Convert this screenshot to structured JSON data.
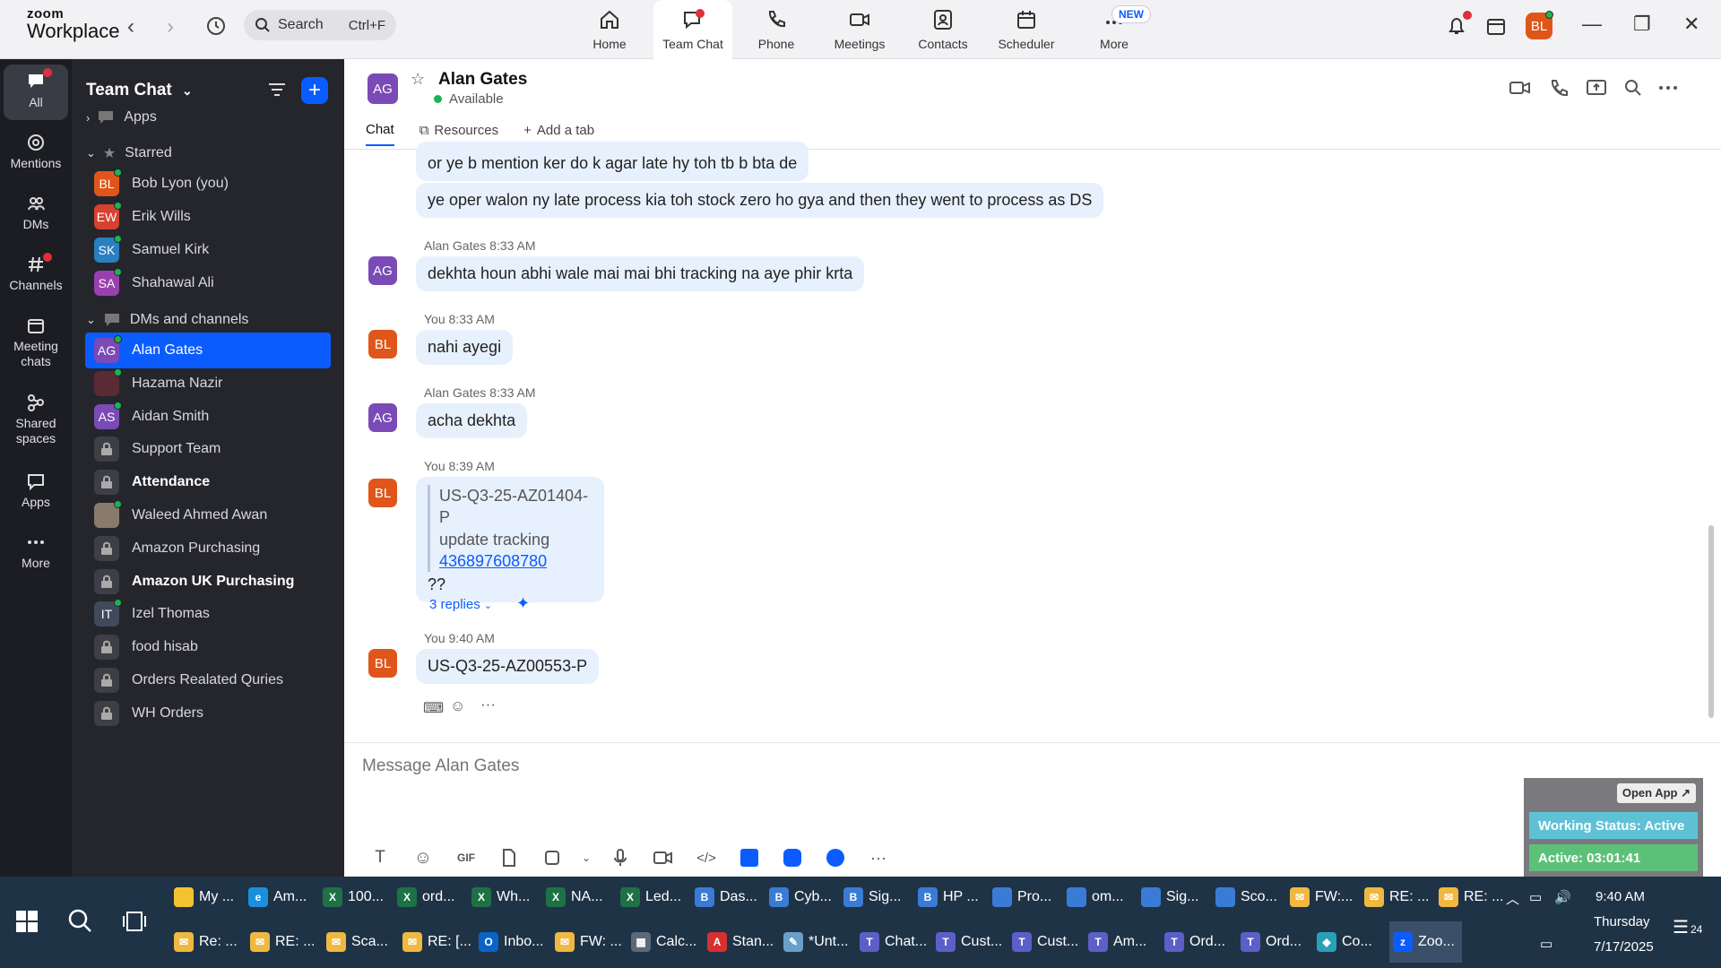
{
  "app": {
    "brand_line1": "zoom",
    "brand_line2": "Workplace"
  },
  "search": {
    "label": "Search",
    "shortcut": "Ctrl+F"
  },
  "nav": [
    {
      "label": "Home",
      "icon": "home-icon"
    },
    {
      "label": "Team Chat",
      "icon": "chat-icon"
    },
    {
      "label": "Phone",
      "icon": "phone-icon"
    },
    {
      "label": "Meetings",
      "icon": "video-icon"
    },
    {
      "label": "Contacts",
      "icon": "contacts-icon"
    },
    {
      "label": "Scheduler",
      "icon": "calendar-icon"
    },
    {
      "label": "More",
      "icon": "more-icon"
    }
  ],
  "nav_badge": "NEW",
  "user_avatar": "BL",
  "rail": [
    {
      "label": "All"
    },
    {
      "label": "Mentions"
    },
    {
      "label": "DMs"
    },
    {
      "label": "Channels"
    },
    {
      "label": "Meeting chats"
    },
    {
      "label": "Shared spaces"
    },
    {
      "label": "Apps"
    },
    {
      "label": "More"
    }
  ],
  "sidebar": {
    "title": "Team Chat",
    "section_apps": "Apps",
    "section_starred": "Starred",
    "section_dms": "DMs and channels",
    "starred": [
      {
        "initials": "BL",
        "name": "Bob Lyon (you)",
        "color": "#e0561a"
      },
      {
        "initials": "EW",
        "name": "Erik Wills",
        "color": "#d8412f"
      },
      {
        "initials": "SK",
        "name": "Samuel Kirk",
        "color": "#2a7fc1"
      },
      {
        "initials": "SA",
        "name": "Shahawal Ali",
        "color": "#9a3fb0"
      }
    ],
    "dms": [
      {
        "initials": "AG",
        "name": "Alan Gates",
        "color": "#7a4ab6",
        "active": true
      },
      {
        "initials": "",
        "name": "Hazama Nazir",
        "color": "#5a2a35"
      },
      {
        "initials": "AS",
        "name": "Aidan Smith",
        "color": "#7a4ab6"
      },
      {
        "initials": "",
        "name": "Support Team",
        "color": "#3d3e46",
        "lock": true
      },
      {
        "initials": "",
        "name": "Attendance",
        "color": "#3d3e46",
        "lock": true,
        "bold": true
      },
      {
        "initials": "",
        "name": "Waleed Ahmed Awan",
        "color": "#8a7a6a"
      },
      {
        "initials": "",
        "name": "Amazon Purchasing",
        "color": "#3d3e46",
        "lock": true
      },
      {
        "initials": "",
        "name": "Amazon UK Purchasing",
        "color": "#3d3e46",
        "lock": true,
        "bold": true
      },
      {
        "initials": "IT",
        "name": "Izel Thomas",
        "color": "#3f4a5a"
      },
      {
        "initials": "",
        "name": "food hisab",
        "color": "#3d3e46",
        "lock": true
      },
      {
        "initials": "",
        "name": "Orders Realated Quries",
        "color": "#3d3e46",
        "lock": true
      },
      {
        "initials": "",
        "name": "WH Orders",
        "color": "#3d3e46",
        "lock": true
      }
    ]
  },
  "chat": {
    "contact_initials": "AG",
    "contact_name": "Alan Gates",
    "contact_status": "Available",
    "tabs": {
      "chat": "Chat",
      "resources": "Resources",
      "add": "Add a tab"
    },
    "msg1": "or ye b mention ker do k agar late hy toh tb b bta de",
    "msg2": "ye oper walon ny late process kia toh stock zero ho gya and then they went to process as DS",
    "meta3": "Alan Gates 8:33 AM",
    "msg3": "dekhta houn abhi wale mai mai bhi tracking na aye phir krta",
    "meta4": "You 8:33 AM",
    "msg4": "nahi ayegi",
    "meta5": "Alan Gates 8:33 AM",
    "msg5": "acha dekhta",
    "meta6": "You 8:39 AM",
    "msg6_quote1": "US-Q3-25-AZ01404-P",
    "msg6_quote2": "update tracking",
    "msg6_link": "436897608780",
    "msg6_text": "??",
    "msg6_replies": "3 replies",
    "meta7": "You 9:40 AM",
    "msg7": "US-Q3-25-AZ00553-P",
    "composer_placeholder": "Message Alan Gates",
    "avatar_you": "BL",
    "gif_label": "GIF"
  },
  "widget": {
    "open": "Open App ↗",
    "status": "Working Status: Active",
    "active": "Active: 03:01:41"
  },
  "taskbar": {
    "row1": [
      {
        "label": "My ...",
        "color": "#f4c430",
        "glyph": ""
      },
      {
        "label": "Am...",
        "color": "#1a8fe0",
        "glyph": "e"
      },
      {
        "label": "100...",
        "color": "#1e7145",
        "glyph": "X"
      },
      {
        "label": "ord...",
        "color": "#1e7145",
        "glyph": "X"
      },
      {
        "label": "Wh...",
        "color": "#1e7145",
        "glyph": "X"
      },
      {
        "label": "NA...",
        "color": "#1e7145",
        "glyph": "X"
      },
      {
        "label": "Led...",
        "color": "#1e7145",
        "glyph": "X"
      },
      {
        "label": "Das...",
        "color": "#3a7bd5",
        "glyph": "B"
      },
      {
        "label": "Cyb...",
        "color": "#3a7bd5",
        "glyph": "B"
      },
      {
        "label": "Sig...",
        "color": "#3a7bd5",
        "glyph": "B"
      },
      {
        "label": "HP ...",
        "color": "#3a7bd5",
        "glyph": "B"
      },
      {
        "label": "Pro...",
        "color": "#3a7bd5",
        "glyph": ""
      },
      {
        "label": "om...",
        "color": "#3a7bd5",
        "glyph": ""
      },
      {
        "label": "Sig...",
        "color": "#3a7bd5",
        "glyph": ""
      },
      {
        "label": "Sco...",
        "color": "#3a7bd5",
        "glyph": ""
      },
      {
        "label": "FW:...",
        "color": "#f0b840",
        "glyph": "✉"
      },
      {
        "label": "RE: ...",
        "color": "#f0b840",
        "glyph": "✉"
      },
      {
        "label": "RE: ...",
        "color": "#f0b840",
        "glyph": "✉"
      }
    ],
    "row2": [
      {
        "label": "Re: ...",
        "color": "#f0b840",
        "glyph": "✉"
      },
      {
        "label": "RE: ...",
        "color": "#f0b840",
        "glyph": "✉"
      },
      {
        "label": "Sca...",
        "color": "#f0b840",
        "glyph": "✉"
      },
      {
        "label": "RE: [...",
        "color": "#f0b840",
        "glyph": "✉"
      },
      {
        "label": "Inbo...",
        "color": "#0a64c8",
        "glyph": "O"
      },
      {
        "label": "FW: ...",
        "color": "#f0b840",
        "glyph": "✉"
      },
      {
        "label": "Calc...",
        "color": "#5a6a7a",
        "glyph": "▦"
      },
      {
        "label": "Stan...",
        "color": "#d8302f",
        "glyph": "A"
      },
      {
        "label": "*Unt...",
        "color": "#6aa0c8",
        "glyph": "✎"
      },
      {
        "label": "Chat...",
        "color": "#5b5fc7",
        "glyph": "T"
      },
      {
        "label": "Cust...",
        "color": "#5b5fc7",
        "glyph": "T"
      },
      {
        "label": "Cust...",
        "color": "#5b5fc7",
        "glyph": "T"
      },
      {
        "label": "Am...",
        "color": "#5b5fc7",
        "glyph": "T"
      },
      {
        "label": "Ord...",
        "color": "#5b5fc7",
        "glyph": "T"
      },
      {
        "label": "Ord...",
        "color": "#5b5fc7",
        "glyph": "T"
      },
      {
        "label": "Co...",
        "color": "#2aa0b8",
        "glyph": "◆"
      },
      {
        "label": "Zoo...",
        "color": "#0b5cff",
        "glyph": "z"
      }
    ],
    "time": "9:40 AM",
    "day": "Thursday",
    "date": "7/17/2025",
    "notif_count": "24"
  }
}
